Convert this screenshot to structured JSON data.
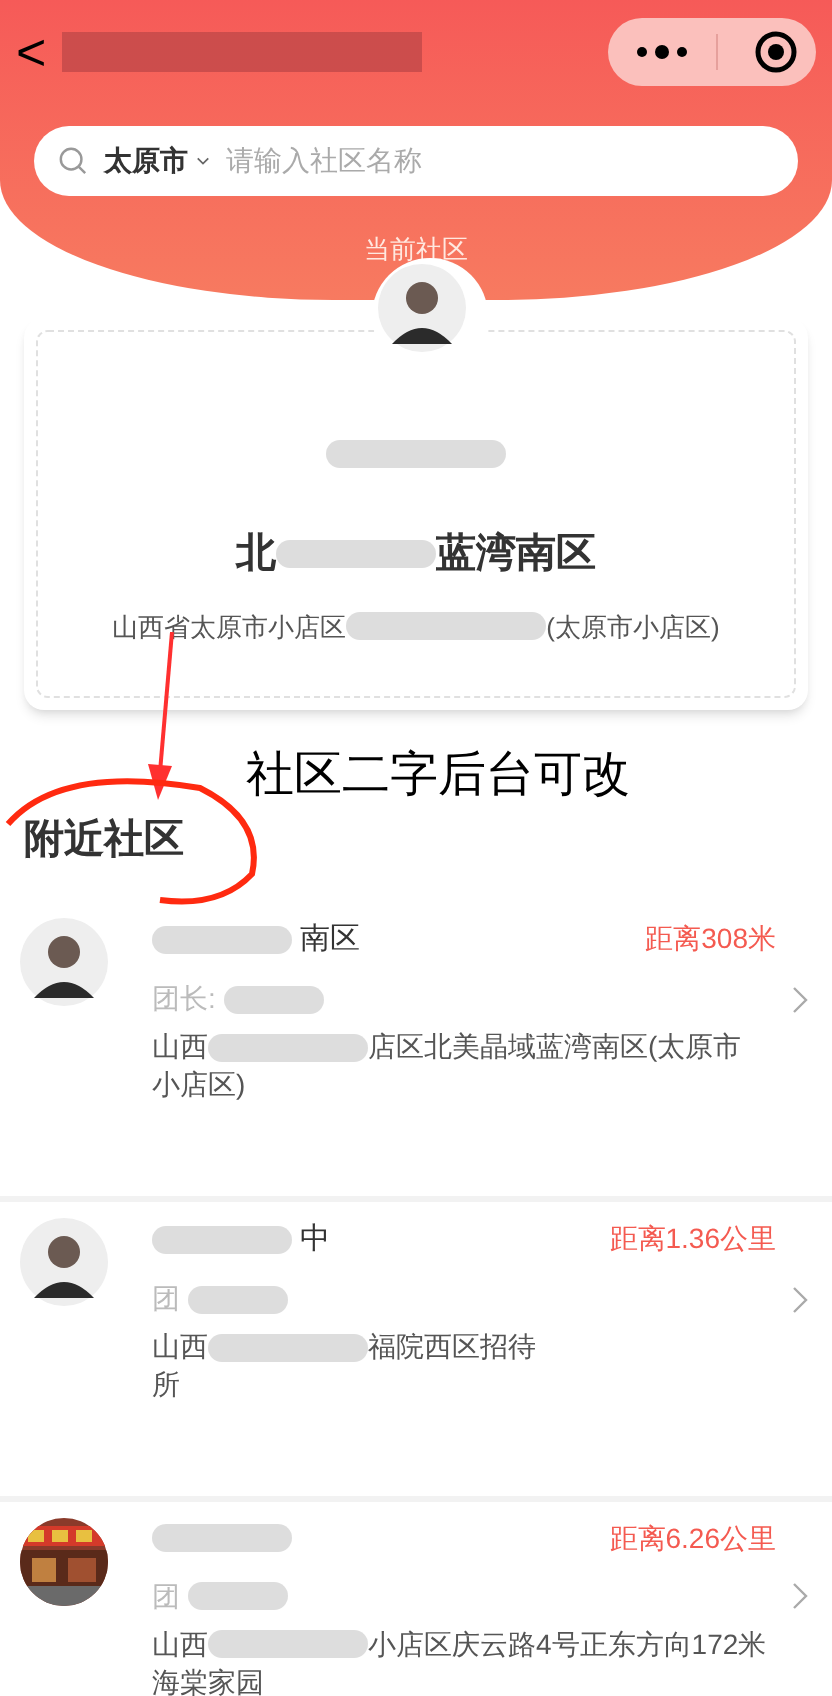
{
  "nav": {
    "back": "<"
  },
  "search": {
    "city": "太原市",
    "placeholder": "请输入社区名称"
  },
  "current": {
    "label": "当前社区",
    "name_start": "北",
    "name_end": "蓝湾南区",
    "address_start": "山西省太原市小店区",
    "address_end": "(太原市小店区)"
  },
  "annotation": {
    "note": "社区二字后台可改"
  },
  "nearby": {
    "title": "附近社区",
    "items": [
      {
        "kind": "person",
        "name": "南区",
        "distance": "距离308米",
        "leader": "团长:",
        "address_start": "山西",
        "address_end": "店区北美晶域蓝湾南区(太原市",
        "address_line2": "小店区)"
      },
      {
        "kind": "person",
        "name": "中",
        "distance": "距离1.36公里",
        "leader": "团",
        "address_start": "山西",
        "address_end": "福院西区招待",
        "address_line2": "所"
      },
      {
        "kind": "picture",
        "distance": "距离6.26公里",
        "leader": "团",
        "address_start": "山西",
        "address_end": "小店区庆云路4号正东方向172米",
        "address_line2": "海棠家园"
      }
    ]
  }
}
